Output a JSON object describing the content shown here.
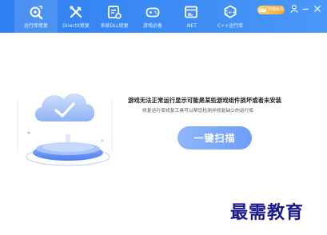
{
  "window": {
    "title": ""
  },
  "tabs": [
    {
      "label": "运行库修复",
      "icon": "wrench-gear-icon",
      "active": true
    },
    {
      "label": "DirectX修复",
      "icon": "tools-icon",
      "active": false
    },
    {
      "label": "系统DLL修复",
      "icon": "document-gear-icon",
      "active": false
    },
    {
      "label": "游戏必备",
      "icon": "gamepad-icon",
      "active": false
    },
    {
      "label": ".NET",
      "icon": "net-window-icon",
      "active": false
    },
    {
      "label": "C++运行库",
      "icon": "cpp-gear-icon",
      "active": false
    }
  ],
  "header": {
    "vip_label": "开通会员",
    "icons": [
      "user-icon",
      "minimize-icon",
      "close-icon"
    ]
  },
  "main": {
    "title": "游戏无法正常运行显示可能是某些游戏组件损坏或者未安装",
    "subtitle": "修复运行库修复工具可以帮您检测并修复缺少的运行库",
    "scan_button": "一键扫描"
  },
  "watermark": "最需教育",
  "colors": {
    "topbar": "#3d8cf5",
    "button": "#7ea9f9",
    "watermark": "#1a1a8c",
    "vip": "#f5b84a"
  }
}
